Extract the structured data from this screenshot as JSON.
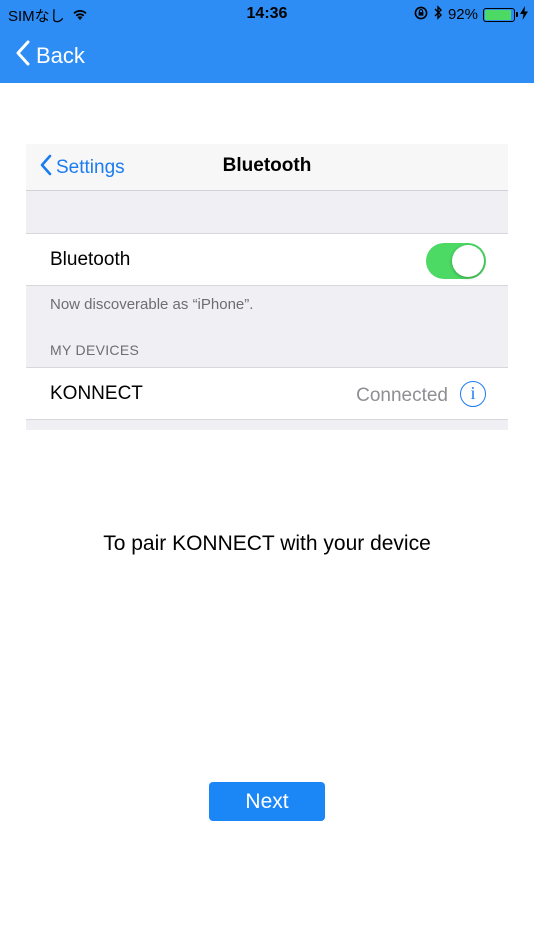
{
  "status_bar": {
    "carrier": "SIMなし",
    "time": "14:36",
    "battery_percent": "92%",
    "battery_level": 0.92
  },
  "nav": {
    "back_label": "Back"
  },
  "settings_screen": {
    "back_label": "Settings",
    "title": "Bluetooth",
    "bluetooth_label": "Bluetooth",
    "bluetooth_on": true,
    "discoverable_note": "Now discoverable as “iPhone”.",
    "section_header": "MY DEVICES",
    "device_name": "KONNECT",
    "device_status": "Connected",
    "info_glyph": "i"
  },
  "instruction": "To pair KONNECT with your device",
  "next_label": "Next",
  "colors": {
    "header_blue": "#2d8df5",
    "button_blue": "#1b86f6",
    "toggle_green": "#4cd964"
  },
  "icons": [
    "wifi-icon",
    "location-lock-icon",
    "bluetooth-icon",
    "battery-icon",
    "charging-icon",
    "chevron-left-icon",
    "info-icon"
  ]
}
